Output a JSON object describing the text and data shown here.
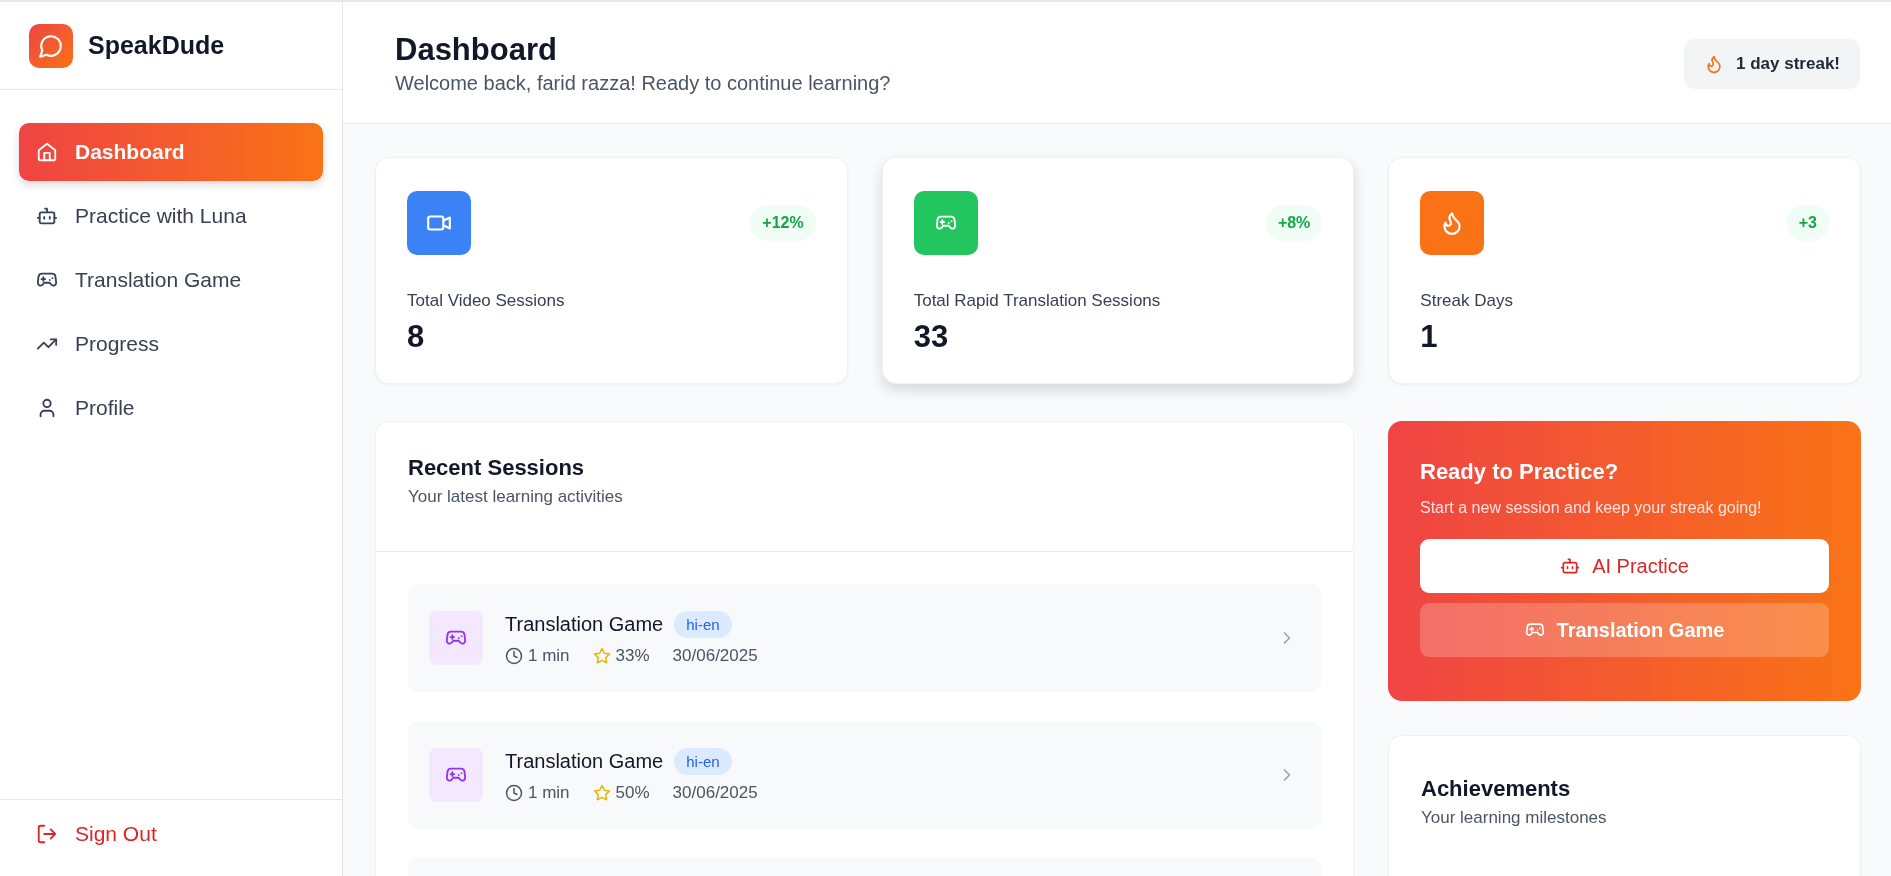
{
  "brand": {
    "name": "SpeakDude"
  },
  "sidebar": {
    "items": [
      {
        "label": "Dashboard",
        "selected": true
      },
      {
        "label": "Practice with Luna",
        "selected": false
      },
      {
        "label": "Translation Game",
        "selected": false
      },
      {
        "label": "Progress",
        "selected": false
      },
      {
        "label": "Profile",
        "selected": false
      }
    ],
    "sign_out": "Sign Out"
  },
  "header": {
    "title": "Dashboard",
    "subtitle": "Welcome back, farid razza! Ready to continue learning?",
    "streak_badge": "1 day streak!"
  },
  "stats": [
    {
      "label": "Total Video Sessions",
      "value": "8",
      "change": "+12%",
      "color": "#3b82f6",
      "raised": false
    },
    {
      "label": "Total Rapid Translation Sessions",
      "value": "33",
      "change": "+8%",
      "color": "#22c55e",
      "raised": true
    },
    {
      "label": "Streak Days",
      "value": "1",
      "change": "+3",
      "color": "#f97316",
      "raised": false
    }
  ],
  "recent_sessions": {
    "title": "Recent Sessions",
    "subtitle": "Your latest learning activities",
    "more_below": true,
    "rows": [
      {
        "title": "Translation Game",
        "tag": "hi-en",
        "duration": "1 min",
        "score": "33%",
        "date": "30/06/2025"
      },
      {
        "title": "Translation Game",
        "tag": "hi-en",
        "duration": "1 min",
        "score": "50%",
        "date": "30/06/2025"
      }
    ]
  },
  "practice": {
    "title": "Ready to Practice?",
    "text": "Start a new session and keep your streak going!",
    "buttons": [
      "AI Practice",
      "Translation Game"
    ]
  },
  "achievements": {
    "title": "Achievements",
    "subtitle": "Your learning milestones"
  }
}
